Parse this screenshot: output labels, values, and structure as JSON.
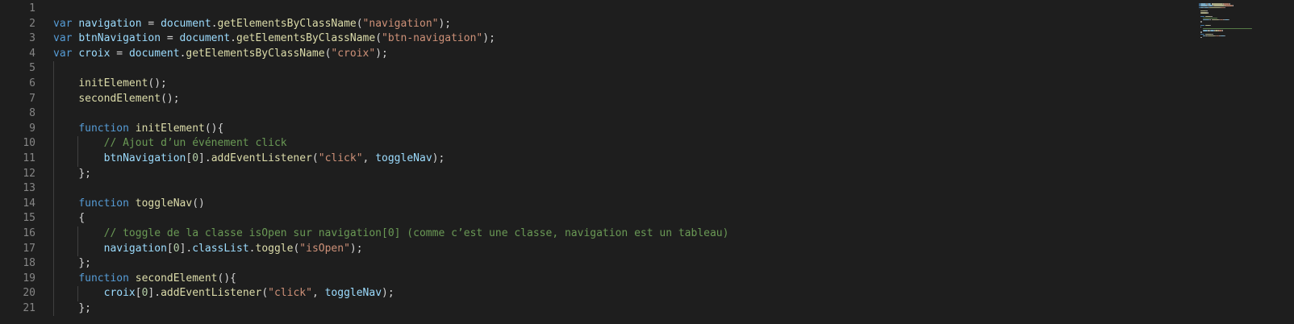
{
  "editor": {
    "line_numbers": [
      "1",
      "2",
      "3",
      "4",
      "5",
      "6",
      "7",
      "8",
      "9",
      "10",
      "11",
      "12",
      "13",
      "14",
      "15",
      "16",
      "17",
      "18",
      "19",
      "20",
      "21"
    ],
    "lines": [
      [],
      [
        {
          "t": "var",
          "c": "kw"
        },
        {
          "t": " ",
          "c": "punc"
        },
        {
          "t": "navigation",
          "c": "var"
        },
        {
          "t": " = ",
          "c": "punc"
        },
        {
          "t": "document",
          "c": "var"
        },
        {
          "t": ".",
          "c": "punc"
        },
        {
          "t": "getElementsByClassName",
          "c": "fn"
        },
        {
          "t": "(",
          "c": "punc"
        },
        {
          "t": "\"navigation\"",
          "c": "str"
        },
        {
          "t": ");",
          "c": "punc"
        }
      ],
      [
        {
          "t": "var",
          "c": "kw"
        },
        {
          "t": " ",
          "c": "punc"
        },
        {
          "t": "btnNavigation",
          "c": "var"
        },
        {
          "t": " = ",
          "c": "punc"
        },
        {
          "t": "document",
          "c": "var"
        },
        {
          "t": ".",
          "c": "punc"
        },
        {
          "t": "getElementsByClassName",
          "c": "fn"
        },
        {
          "t": "(",
          "c": "punc"
        },
        {
          "t": "\"btn-navigation\"",
          "c": "str"
        },
        {
          "t": ");",
          "c": "punc"
        }
      ],
      [
        {
          "t": "var",
          "c": "kw"
        },
        {
          "t": " ",
          "c": "punc"
        },
        {
          "t": "croix",
          "c": "var"
        },
        {
          "t": " = ",
          "c": "punc"
        },
        {
          "t": "document",
          "c": "var"
        },
        {
          "t": ".",
          "c": "punc"
        },
        {
          "t": "getElementsByClassName",
          "c": "fn"
        },
        {
          "t": "(",
          "c": "punc"
        },
        {
          "t": "\"croix\"",
          "c": "str"
        },
        {
          "t": ");",
          "c": "punc"
        }
      ],
      [],
      [
        {
          "t": "    ",
          "c": "punc"
        },
        {
          "t": "initElement",
          "c": "fn"
        },
        {
          "t": "();",
          "c": "punc"
        }
      ],
      [
        {
          "t": "    ",
          "c": "punc"
        },
        {
          "t": "secondElement",
          "c": "fn"
        },
        {
          "t": "();",
          "c": "punc"
        }
      ],
      [],
      [
        {
          "t": "    ",
          "c": "punc"
        },
        {
          "t": "function",
          "c": "kw"
        },
        {
          "t": " ",
          "c": "punc"
        },
        {
          "t": "initElement",
          "c": "fn"
        },
        {
          "t": "(){",
          "c": "punc"
        }
      ],
      [
        {
          "t": "        ",
          "c": "punc"
        },
        {
          "t": "// Ajout d’un événement click",
          "c": "cmt"
        }
      ],
      [
        {
          "t": "        ",
          "c": "punc"
        },
        {
          "t": "btnNavigation",
          "c": "var"
        },
        {
          "t": "[",
          "c": "punc"
        },
        {
          "t": "0",
          "c": "num"
        },
        {
          "t": "].",
          "c": "punc"
        },
        {
          "t": "addEventListener",
          "c": "fn"
        },
        {
          "t": "(",
          "c": "punc"
        },
        {
          "t": "\"click\"",
          "c": "str"
        },
        {
          "t": ", ",
          "c": "punc"
        },
        {
          "t": "toggleNav",
          "c": "var"
        },
        {
          "t": ");",
          "c": "punc"
        }
      ],
      [
        {
          "t": "    ",
          "c": "punc"
        },
        {
          "t": "};",
          "c": "punc"
        }
      ],
      [],
      [
        {
          "t": "    ",
          "c": "punc"
        },
        {
          "t": "function",
          "c": "kw"
        },
        {
          "t": " ",
          "c": "punc"
        },
        {
          "t": "toggleNav",
          "c": "fn"
        },
        {
          "t": "()",
          "c": "punc"
        }
      ],
      [
        {
          "t": "    ",
          "c": "punc"
        },
        {
          "t": "{",
          "c": "punc"
        }
      ],
      [
        {
          "t": "        ",
          "c": "punc"
        },
        {
          "t": "// toggle de la classe isOpen sur navigation[0] (comme c’est une classe, navigation est un tableau)",
          "c": "cmt"
        }
      ],
      [
        {
          "t": "        ",
          "c": "punc"
        },
        {
          "t": "navigation",
          "c": "var"
        },
        {
          "t": "[",
          "c": "punc"
        },
        {
          "t": "0",
          "c": "num"
        },
        {
          "t": "].",
          "c": "punc"
        },
        {
          "t": "classList",
          "c": "var"
        },
        {
          "t": ".",
          "c": "punc"
        },
        {
          "t": "toggle",
          "c": "fn"
        },
        {
          "t": "(",
          "c": "punc"
        },
        {
          "t": "\"isOpen\"",
          "c": "str"
        },
        {
          "t": ");",
          "c": "punc"
        }
      ],
      [
        {
          "t": "    ",
          "c": "punc"
        },
        {
          "t": "};",
          "c": "punc"
        }
      ],
      [
        {
          "t": "    ",
          "c": "punc"
        },
        {
          "t": "function",
          "c": "kw"
        },
        {
          "t": " ",
          "c": "punc"
        },
        {
          "t": "secondElement",
          "c": "fn"
        },
        {
          "t": "(){",
          "c": "punc"
        }
      ],
      [
        {
          "t": "        ",
          "c": "punc"
        },
        {
          "t": "croix",
          "c": "var"
        },
        {
          "t": "[",
          "c": "punc"
        },
        {
          "t": "0",
          "c": "num"
        },
        {
          "t": "].",
          "c": "punc"
        },
        {
          "t": "addEventListener",
          "c": "fn"
        },
        {
          "t": "(",
          "c": "punc"
        },
        {
          "t": "\"click\"",
          "c": "str"
        },
        {
          "t": ", ",
          "c": "punc"
        },
        {
          "t": "toggleNav",
          "c": "var"
        },
        {
          "t": ");",
          "c": "punc"
        }
      ],
      [
        {
          "t": "    ",
          "c": "punc"
        },
        {
          "t": "};",
          "c": "punc"
        }
      ]
    ],
    "indent_guides": [
      [],
      [],
      [],
      [],
      [
        1
      ],
      [
        1
      ],
      [
        1
      ],
      [
        1
      ],
      [
        1
      ],
      [
        1,
        2
      ],
      [
        1,
        2
      ],
      [
        1
      ],
      [
        1
      ],
      [
        1
      ],
      [
        1
      ],
      [
        1,
        2
      ],
      [
        1,
        2
      ],
      [
        1
      ],
      [
        1
      ],
      [
        1,
        2
      ],
      [
        1
      ]
    ]
  },
  "colors": {
    "background": "#1e1e1e",
    "line_number": "#858585",
    "keyword": "#569cd6",
    "variable": "#9cdcfe",
    "function": "#dcdcaa",
    "string": "#ce9178",
    "number": "#b5cea8",
    "comment": "#6a9955",
    "punctuation": "#d4d4d4"
  }
}
